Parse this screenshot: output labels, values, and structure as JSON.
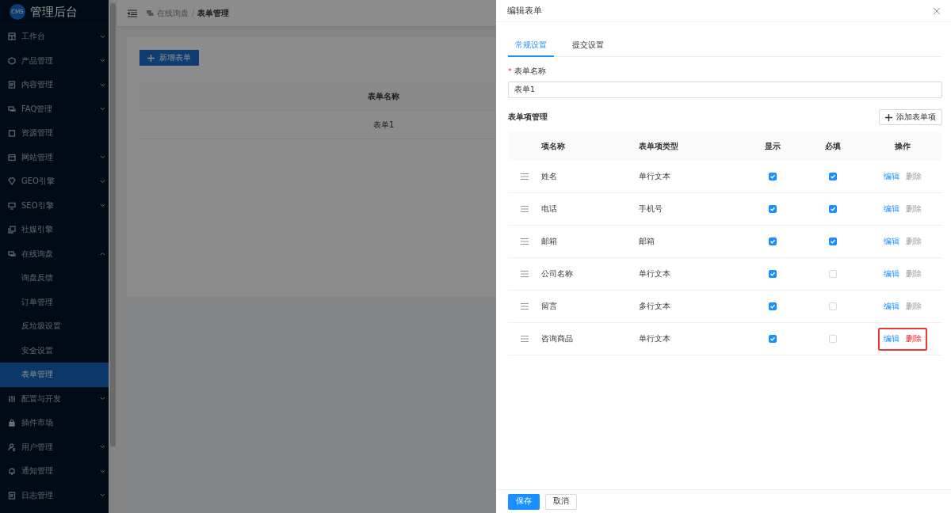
{
  "sidebar": {
    "logo": "CMS",
    "title": "管理后台",
    "items": [
      {
        "label": "工作台",
        "expanded": false,
        "selected": false
      },
      {
        "label": "产品管理",
        "expanded": false,
        "selected": false
      },
      {
        "label": "内容管理",
        "expanded": false,
        "selected": false
      },
      {
        "label": "FAQ管理",
        "expanded": false,
        "selected": false
      },
      {
        "label": "资源管理",
        "selected": false
      },
      {
        "label": "网站管理",
        "expanded": false,
        "selected": false
      },
      {
        "label": "GEO引擎",
        "expanded": false,
        "selected": false
      },
      {
        "label": "SEO引擎",
        "expanded": false,
        "selected": false
      },
      {
        "label": "社媒引擎",
        "selected": false
      },
      {
        "label": "在线询盘",
        "expanded": true,
        "selected": false,
        "children": [
          {
            "label": "询盘反馈",
            "selected": false
          },
          {
            "label": "订单管理",
            "selected": false
          },
          {
            "label": "反垃圾设置",
            "selected": false
          },
          {
            "label": "安全设置",
            "selected": false
          },
          {
            "label": "表单管理",
            "selected": true
          }
        ]
      },
      {
        "label": "配置与开发",
        "expanded": false,
        "selected": false
      },
      {
        "label": "插件市场",
        "selected": false
      },
      {
        "label": "用户管理",
        "expanded": false,
        "selected": false
      },
      {
        "label": "通知管理",
        "expanded": false,
        "selected": false
      },
      {
        "label": "日志管理",
        "expanded": false,
        "selected": false
      }
    ]
  },
  "breadcrumb": {
    "items": [
      "在线询盘",
      "表单管理"
    ],
    "separator": "/"
  },
  "page": {
    "new_button": "新增表单",
    "table": {
      "columns": [
        "表单名称"
      ],
      "rows": [
        [
          "表单1"
        ]
      ]
    }
  },
  "drawer": {
    "title": "编辑表单",
    "tabs": [
      {
        "label": "常规设置",
        "selected": true
      },
      {
        "label": "提交设置",
        "selected": false
      }
    ],
    "name_field": {
      "label": "表单名称",
      "required_mark": "*",
      "value": "表单1"
    },
    "section_title": "表单项管理",
    "add_button": "添加表单项",
    "columns": [
      "项名称",
      "表单项类型",
      "显示",
      "必填",
      "操作"
    ],
    "rows": [
      {
        "name": "姓名",
        "type": "单行文本",
        "visible": true,
        "required": true,
        "edit": "编辑",
        "delete": "删除",
        "delete_enabled": false,
        "highlighted": false
      },
      {
        "name": "电话",
        "type": "手机号",
        "visible": true,
        "required": true,
        "edit": "编辑",
        "delete": "删除",
        "delete_enabled": false,
        "highlighted": false
      },
      {
        "name": "邮箱",
        "type": "邮箱",
        "visible": true,
        "required": true,
        "edit": "编辑",
        "delete": "删除",
        "delete_enabled": false,
        "highlighted": false
      },
      {
        "name": "公司名称",
        "type": "单行文本",
        "visible": true,
        "required": false,
        "edit": "编辑",
        "delete": "删除",
        "delete_enabled": false,
        "highlighted": false
      },
      {
        "name": "留言",
        "type": "多行文本",
        "visible": true,
        "required": false,
        "edit": "编辑",
        "delete": "删除",
        "delete_enabled": false,
        "highlighted": false
      },
      {
        "name": "咨询商品",
        "type": "单行文本",
        "visible": true,
        "required": false,
        "edit": "编辑",
        "delete": "删除",
        "delete_enabled": true,
        "highlighted": true
      }
    ],
    "save_button": "保存",
    "cancel_button": "取消"
  }
}
